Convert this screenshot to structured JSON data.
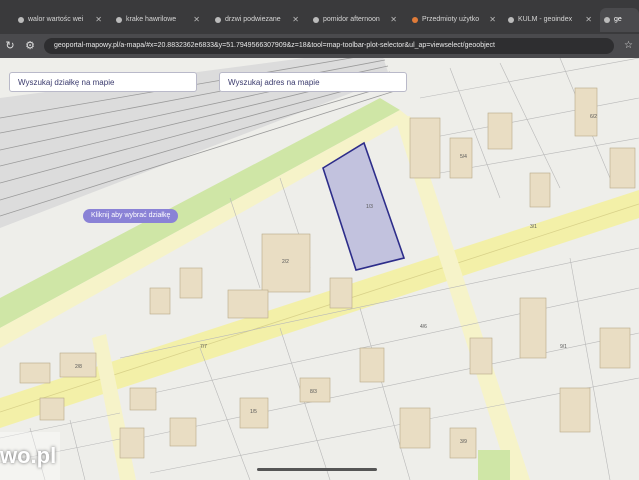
{
  "browser": {
    "tabs": [
      {
        "label": "walor wartośc wei"
      },
      {
        "label": "krake hawrilowe"
      },
      {
        "label": "drzwi podwiezane"
      },
      {
        "label": "pomidor afternoon"
      },
      {
        "label": "Przedmioty użytko"
      },
      {
        "label": "KULM - geoindex"
      },
      {
        "label": "ge"
      }
    ],
    "url": "geoportal-mapowy.pl/a-mapa/#x=20.8832362e6833&y=51.7949566307909&z=18&tool=map-toolbar-plot-selector&ul_ap=viewselect/geoobject"
  },
  "map": {
    "search_plot": "Wyszukaj działkę na mapie",
    "search_address": "Wyszukaj adres na mapie",
    "hint": "Kliknij aby wybrać działkę",
    "parcel_labels": [
      "1/3",
      "2/2",
      "5/4",
      "3/1",
      "7/7",
      "4/6",
      "2/8",
      "9/1",
      "8/3",
      "6/2",
      "1/5",
      "3/9"
    ],
    "colors": {
      "selection": "#6f6fc8",
      "road": "#f3f0a8",
      "green": "#cfe6a6",
      "building": "#e9ddc3"
    }
  },
  "watermark": "wo.pl"
}
